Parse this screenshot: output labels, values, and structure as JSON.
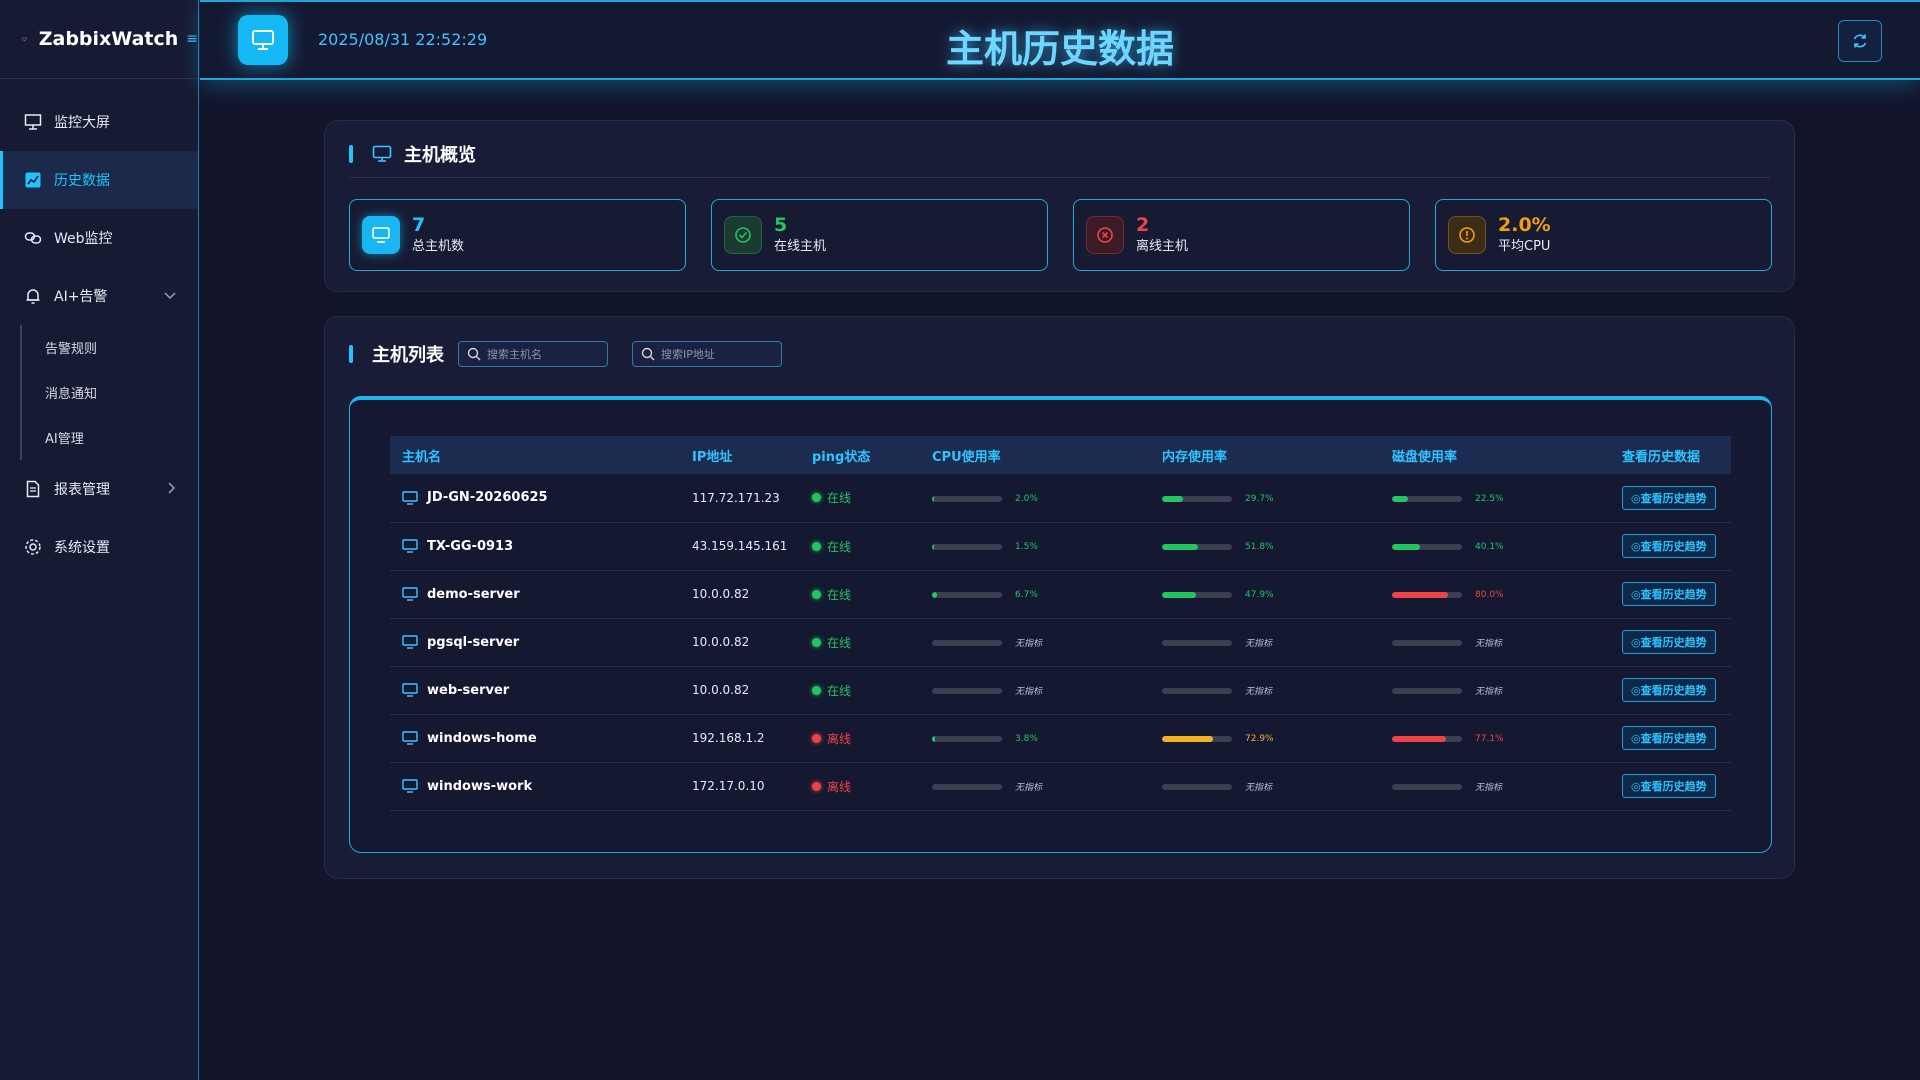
{
  "app": {
    "name": "ZabbixWatch",
    "menu_toggle": "≡"
  },
  "sidebar": {
    "items": [
      {
        "label": "监控大屏",
        "icon": "monitor-icon",
        "active": false
      },
      {
        "label": "历史数据",
        "icon": "chart-icon",
        "active": true
      },
      {
        "label": "Web监控",
        "icon": "link-icon",
        "active": false
      },
      {
        "label": "AI+告警",
        "icon": "bell-icon",
        "active": false,
        "expanded": true
      },
      {
        "label": "报表管理",
        "icon": "document-icon",
        "active": false
      },
      {
        "label": "系统设置",
        "icon": "gear-icon",
        "active": false
      }
    ],
    "submenu": [
      "告警规则",
      "消息通知",
      "AI管理"
    ]
  },
  "header": {
    "datetime": "2025/08/31 22:52:29",
    "title": "主机历史数据"
  },
  "overview": {
    "title": "主机概览",
    "stats": [
      {
        "value": "7",
        "label": "总主机数",
        "color": "#22c4ff",
        "icon": "monitor-icon"
      },
      {
        "value": "5",
        "label": "在线主机",
        "color": "#22c55e",
        "icon": "check-circle-icon"
      },
      {
        "value": "2",
        "label": "离线主机",
        "color": "#ef4444",
        "icon": "x-circle-icon"
      },
      {
        "value": "2.0%",
        "label": "平均CPU",
        "color": "#f59e0b",
        "icon": "alert-circle-icon"
      }
    ]
  },
  "hostlist": {
    "title": "主机列表",
    "search_host_placeholder": "搜索主机名",
    "search_ip_placeholder": "搜索IP地址",
    "columns": [
      "主机名",
      "IP地址",
      "ping状态",
      "CPU使用率",
      "内存使用率",
      "磁盘使用率",
      "查看历史数据"
    ],
    "trend_label": "◎查看历史趋势",
    "na_label": "无指标",
    "rows": [
      {
        "host": "JD-GN-20260625",
        "ip": "117.72.171.23",
        "status": "在线",
        "online": true,
        "cpu": 2.0,
        "cpu_text": "2.0%",
        "mem": 29.7,
        "mem_text": "29.7%",
        "disk": 22.5,
        "disk_text": "22.5%"
      },
      {
        "host": "TX-GG-0913",
        "ip": "43.159.145.161",
        "status": "在线",
        "online": true,
        "cpu": 1.5,
        "cpu_text": "1.5%",
        "mem": 51.8,
        "mem_text": "51.8%",
        "disk": 40.1,
        "disk_text": "40.1%"
      },
      {
        "host": "demo-server",
        "ip": "10.0.0.82",
        "status": "在线",
        "online": true,
        "cpu": 6.7,
        "cpu_text": "6.7%",
        "mem": 47.9,
        "mem_text": "47.9%",
        "disk": 80.0,
        "disk_text": "80.0%"
      },
      {
        "host": "pgsql-server",
        "ip": "10.0.0.82",
        "status": "在线",
        "online": true,
        "cpu": null,
        "cpu_text": null,
        "mem": null,
        "mem_text": null,
        "disk": null,
        "disk_text": null
      },
      {
        "host": "web-server",
        "ip": "10.0.0.82",
        "status": "在线",
        "online": true,
        "cpu": null,
        "cpu_text": null,
        "mem": null,
        "mem_text": null,
        "disk": null,
        "disk_text": null
      },
      {
        "host": "windows-home",
        "ip": "192.168.1.2",
        "status": "离线",
        "online": false,
        "cpu": 3.8,
        "cpu_text": "3.8%",
        "mem": 72.9,
        "mem_text": "72.9%",
        "disk": 77.1,
        "disk_text": "77.1%"
      },
      {
        "host": "windows-work",
        "ip": "172.17.0.10",
        "status": "离线",
        "online": false,
        "cpu": null,
        "cpu_text": null,
        "mem": null,
        "mem_text": null,
        "disk": null,
        "disk_text": null
      }
    ]
  },
  "colors": {
    "accent": "#22c4ff",
    "online": "#22c55e",
    "offline": "#ef4444",
    "warning": "#f5b321",
    "danger": "#ef4444",
    "ok": "#22c55e"
  }
}
